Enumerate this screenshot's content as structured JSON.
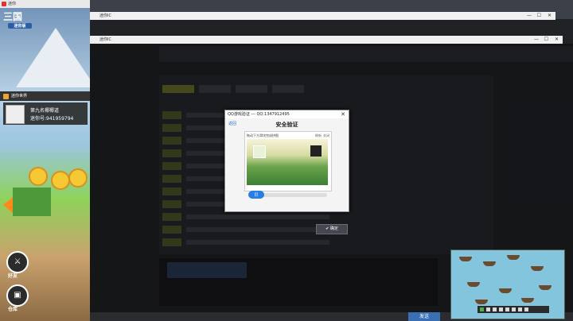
{
  "left_window": {
    "title": "迷你",
    "logo_main": "三国",
    "logo_sub": "迷你版",
    "banner_label": "迷你世界",
    "player_name": "第九名椰椰道",
    "player_id": "迷你号:941959794",
    "buttons": [
      {
        "label": "好友"
      },
      {
        "label": "仓库"
      }
    ]
  },
  "window1": {
    "title": "迷你IC"
  },
  "window2": {
    "title": "迷你IC"
  },
  "captcha_dialog": {
    "window_title": "QQ游戏验证 --- QQ:1347912495",
    "back_label": "返回",
    "heading": "安全验证",
    "hint": "拖动下方滑块完成拼图",
    "refresh_label": "刷新",
    "close_label": "关闭",
    "slider_handle_glyph": "|||"
  },
  "confirm_button": {
    "label": "确定"
  },
  "bottom": {
    "send_label": "发送"
  }
}
